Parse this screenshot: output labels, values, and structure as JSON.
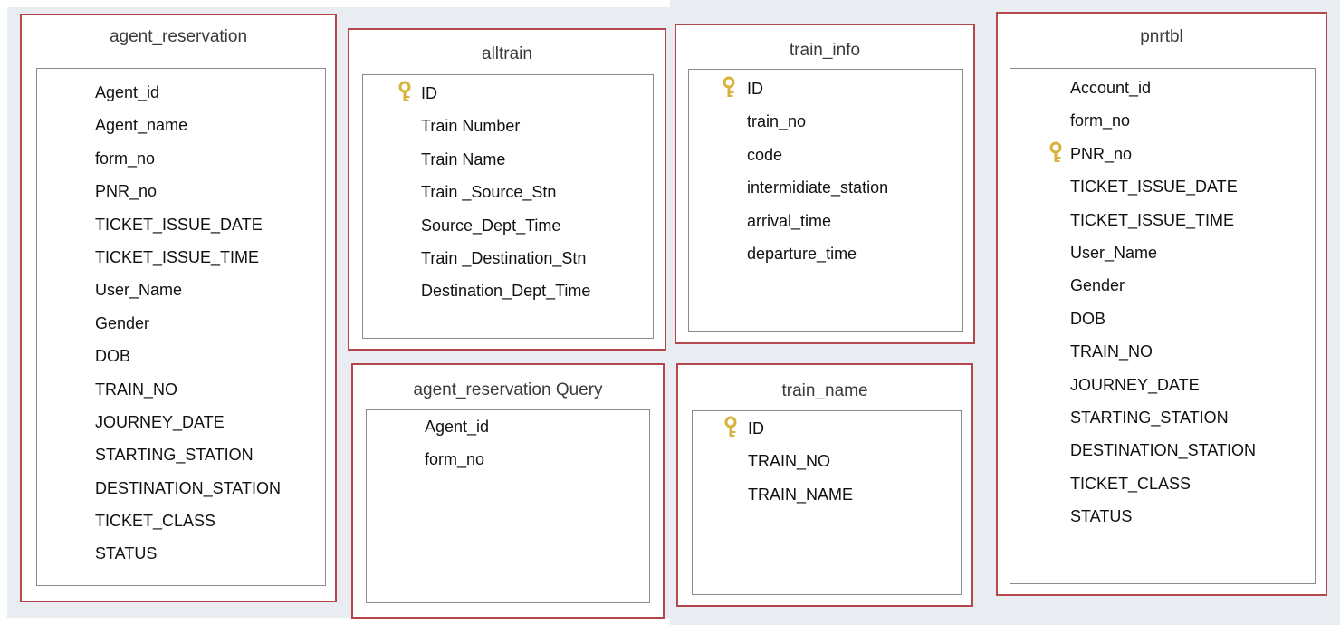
{
  "colors": {
    "table_border": "#b3474d",
    "inner_border": "#8b8b8b",
    "background_strip": "#e9ecf0",
    "key_icon": "#d9b23a"
  },
  "tables": {
    "agent_reservation": {
      "title": "agent_reservation",
      "fields": [
        "Agent_id",
        "Agent_name",
        "form_no",
        "PNR_no",
        "TICKET_ISSUE_DATE",
        "TICKET_ISSUE_TIME",
        "User_Name",
        "Gender",
        "DOB",
        "TRAIN_NO",
        "JOURNEY_DATE",
        "STARTING_STATION",
        "DESTINATION_STATION",
        "TICKET_CLASS",
        "STATUS"
      ]
    },
    "alltrain": {
      "title": "alltrain",
      "key_icon": "key-icon",
      "fields": [
        "ID",
        "Train Number",
        "Train Name",
        "Train _Source_Stn",
        "Source_Dept_Time",
        "Train _Destination_Stn",
        "Destination_Dept_Time"
      ]
    },
    "agent_reservation_query": {
      "title": "agent_reservation Query",
      "fields": [
        "Agent_id",
        "form_no"
      ]
    },
    "train_info": {
      "title": "train_info",
      "key_icon": "key-icon",
      "fields": [
        "ID",
        "train_no",
        "code",
        "intermidiate_station",
        "arrival_time",
        "departure_time"
      ]
    },
    "train_name": {
      "title": "train_name",
      "key_icon": "key-icon",
      "fields": [
        "ID",
        "TRAIN_NO",
        "TRAIN_NAME"
      ]
    },
    "pnrtbl": {
      "title": "pnrtbl",
      "key_icon": "key-icon",
      "fields": [
        "Account_id",
        "form_no",
        "PNR_no",
        "TICKET_ISSUE_DATE",
        "TICKET_ISSUE_TIME",
        "User_Name",
        "Gender",
        "DOB",
        "TRAIN_NO",
        "JOURNEY_DATE",
        "STARTING_STATION",
        "DESTINATION_STATION",
        "TICKET_CLASS",
        "STATUS"
      ]
    }
  }
}
